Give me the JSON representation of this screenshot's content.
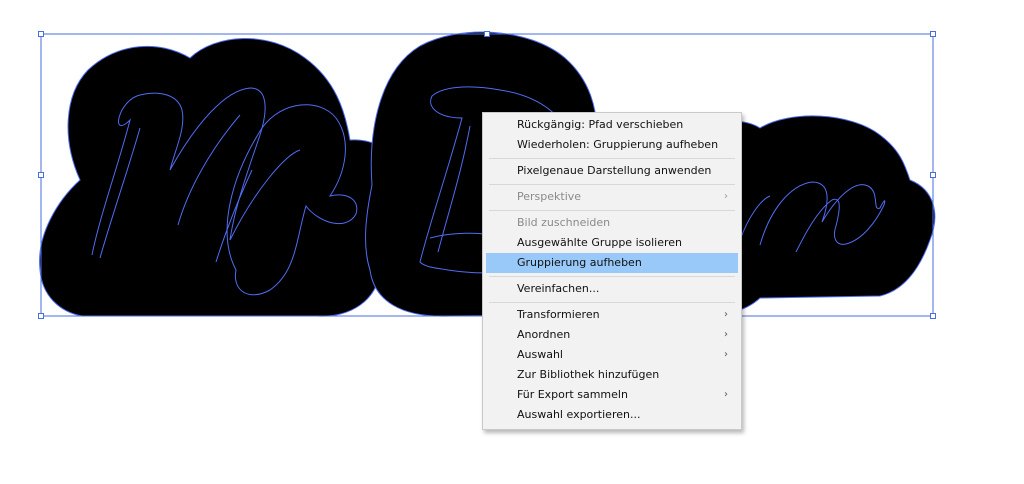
{
  "artwork": {
    "text_shapes": [
      "M",
      "r",
      "B",
      "m"
    ],
    "colors": {
      "fill": "#000000",
      "outline": "#4f6df2",
      "selection": "#4a6ee0",
      "background": "#ffffff"
    }
  },
  "context_menu": {
    "highlight_color": "#99c9f8",
    "items": [
      {
        "label": "Rückgängig: Pfad verschieben",
        "enabled": true
      },
      {
        "label": "Wiederholen: Gruppierung aufheben",
        "enabled": true
      },
      {
        "separator": true
      },
      {
        "label": "Pixelgenaue Darstellung anwenden",
        "enabled": true
      },
      {
        "separator": true
      },
      {
        "label": "Perspektive",
        "enabled": false,
        "submenu": true
      },
      {
        "separator": true
      },
      {
        "label": "Bild zuschneiden",
        "enabled": false
      },
      {
        "label": "Ausgewählte Gruppe isolieren",
        "enabled": true
      },
      {
        "label": "Gruppierung aufheben",
        "enabled": true,
        "highlighted": true
      },
      {
        "separator": true
      },
      {
        "label": "Vereinfachen...",
        "enabled": true
      },
      {
        "separator": true
      },
      {
        "label": "Transformieren",
        "enabled": true,
        "submenu": true
      },
      {
        "label": "Anordnen",
        "enabled": true,
        "submenu": true
      },
      {
        "label": "Auswahl",
        "enabled": true,
        "submenu": true
      },
      {
        "label": "Zur Bibliothek hinzufügen",
        "enabled": true
      },
      {
        "label": "Für Export sammeln",
        "enabled": true,
        "submenu": true
      },
      {
        "label": "Auswahl exportieren...",
        "enabled": true
      }
    ]
  }
}
